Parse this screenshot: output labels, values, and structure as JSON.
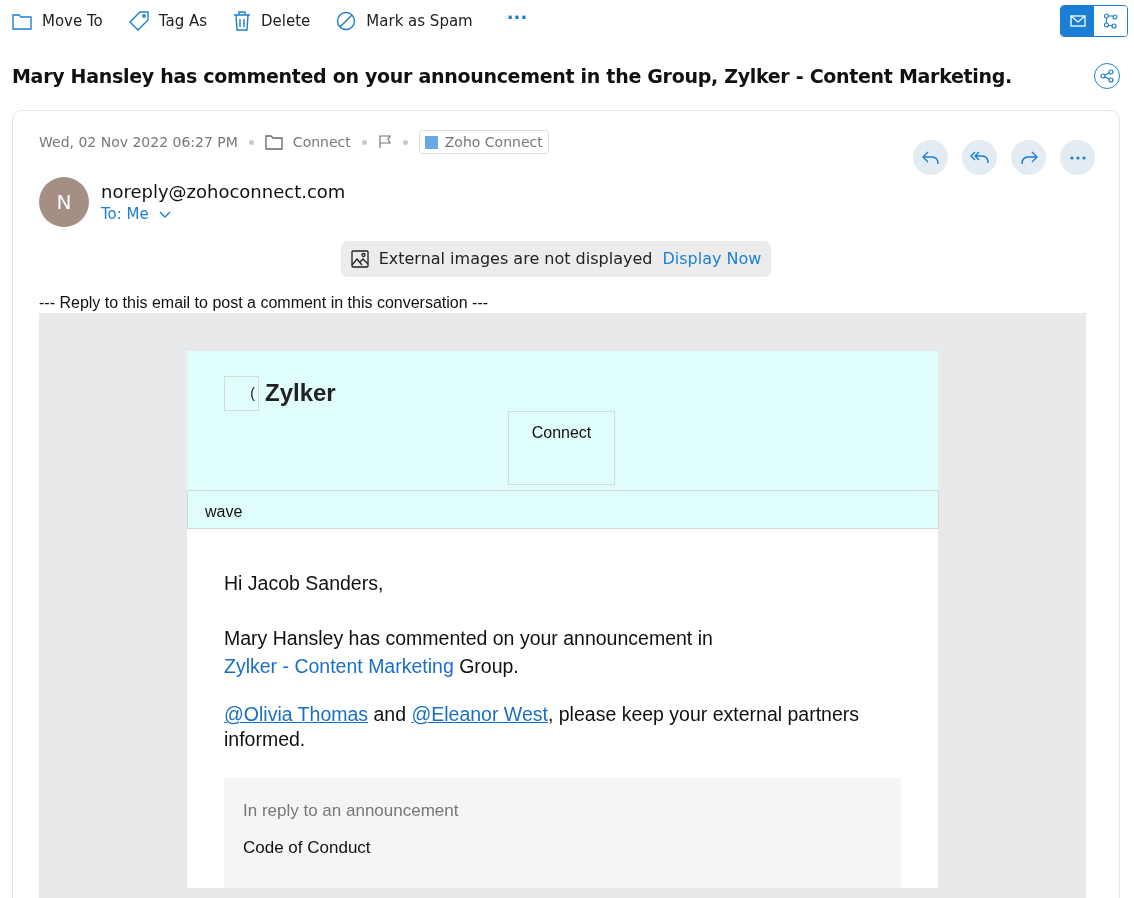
{
  "toolbar": {
    "actions": [
      {
        "kind": "folder",
        "label": "Move To"
      },
      {
        "kind": "tag",
        "label": "Tag As"
      },
      {
        "kind": "trash",
        "label": "Delete"
      },
      {
        "kind": "spam",
        "label": "Mark as Spam"
      },
      {
        "kind": "more",
        "label": "···"
      }
    ],
    "view_toggle": [
      {
        "kind": "mail",
        "selected": true
      },
      {
        "kind": "thread",
        "selected": false
      }
    ]
  },
  "subject": "Mary Hansley has commented on your announcement in the Group, Zylker - Content Marketing.",
  "message": {
    "date": "Wed, 02 Nov 2022 06:27 PM",
    "folder": "Connect",
    "flagged": false,
    "tag": {
      "label": "Zoho Connect",
      "color": "#6aaae4"
    },
    "avatar": "N",
    "sender": "noreply@zohoconnect.com",
    "to": "To: Me",
    "notice": {
      "text": "External images are not displayed",
      "action": "Display Now"
    }
  },
  "body": {
    "intro": "--- Reply to this email to post a comment in this conversation ---",
    "header": {
      "logo_text": "(",
      "brand": "Zylker",
      "product": "Connect",
      "banner": "wave"
    },
    "greeting": "Hi Jacob Sanders,",
    "paragraph_1": {
      "before": "Mary Hansley has commented on your announcement in ",
      "link": "Zylker - Content Marketing",
      "after": " Group."
    },
    "paragraph_2": {
      "mention_1": "@Olivia Thomas",
      "middle": " and ",
      "mention_2": "@Eleanor West",
      "after": ", please keep your external partners informed."
    },
    "quote": {
      "label": "In reply to an announcement",
      "title": "Code of Conduct"
    }
  }
}
